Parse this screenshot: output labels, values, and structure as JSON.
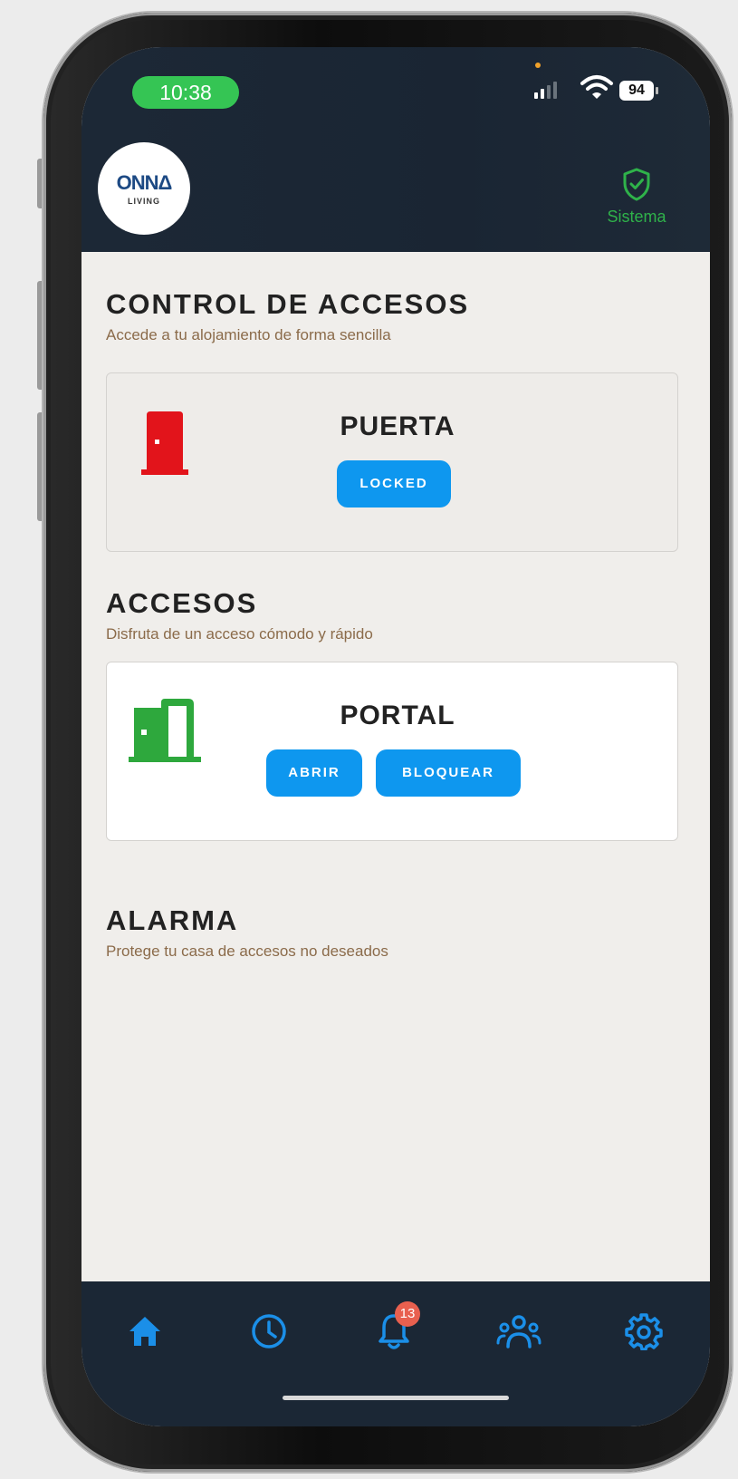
{
  "status_bar": {
    "time": "10:38",
    "battery": "94"
  },
  "header": {
    "logo_main": "ONNΔ",
    "logo_sub": "LIVING",
    "system_label": "Sistema",
    "system_icon": "shield-check-icon"
  },
  "sections": {
    "control": {
      "title": "CONTROL DE ACCESOS",
      "subtitle": "Accede a tu alojamiento de forma sencilla",
      "card": {
        "name": "PUERTA",
        "status_button": "LOCKED",
        "door_icon_color": "#e2141b"
      }
    },
    "accesos": {
      "title": "ACCESOS",
      "subtitle": "Disfruta de un acceso cómodo y rápido",
      "card": {
        "name": "PORTAL",
        "open_button": "ABRIR",
        "lock_button": "BLOQUEAR",
        "door_icon_color": "#2ea83d"
      }
    },
    "alarma": {
      "title": "ALARMA",
      "subtitle": "Protege tu casa de accesos no deseados"
    }
  },
  "nav": {
    "items": [
      {
        "icon": "home-icon"
      },
      {
        "icon": "clock-icon"
      },
      {
        "icon": "bell-icon",
        "badge": "13"
      },
      {
        "icon": "users-icon"
      },
      {
        "icon": "gear-icon"
      }
    ]
  },
  "colors": {
    "accent": "#0e97ef",
    "header_bg": "#1c2836",
    "success": "#2fb24a",
    "badge": "#e8604f"
  }
}
